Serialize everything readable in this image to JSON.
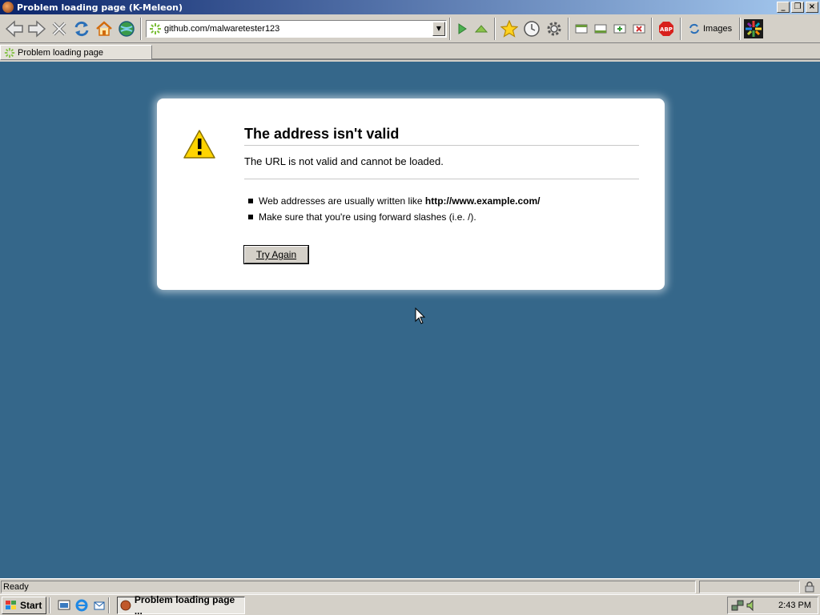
{
  "window": {
    "title": "Problem loading page (K-Meleon)",
    "controls": [
      "minimize",
      "restore",
      "close"
    ]
  },
  "toolbar": {
    "url": "github.com/malwaretester123",
    "images_label": "Images",
    "icons": [
      "back-icon",
      "forward-icon",
      "stop-icon",
      "reload-icon",
      "home-icon",
      "globe-icon",
      "go-icon",
      "up-icon",
      "bookmarks-star-icon",
      "history-clock-icon",
      "settings-gear-icon",
      "window-a-icon",
      "window-b-icon",
      "new-tab-icon",
      "close-tab-icon",
      "adblock-abp-icon",
      "images-icon",
      "kmeleon-logo-icon"
    ]
  },
  "tab": {
    "label": "Problem loading page"
  },
  "error": {
    "title": "The address isn't valid",
    "description": "The URL is not valid and cannot be loaded.",
    "bullets": [
      {
        "text": "Web addresses are usually written like ",
        "bold": "http://www.example.com/"
      },
      {
        "text": "Make sure that you're using forward slashes (i.e. /).",
        "bold": ""
      }
    ],
    "button_label": "Try Again"
  },
  "status": {
    "text": "Ready"
  },
  "taskbar": {
    "start_label": "Start",
    "task_label": "Problem loading page ...",
    "clock": "2:43 PM"
  },
  "colors": {
    "content_bg": "#35678a",
    "titlebar_start": "#0a246a",
    "titlebar_end": "#a6caf0",
    "chrome": "#d4d0c8"
  }
}
